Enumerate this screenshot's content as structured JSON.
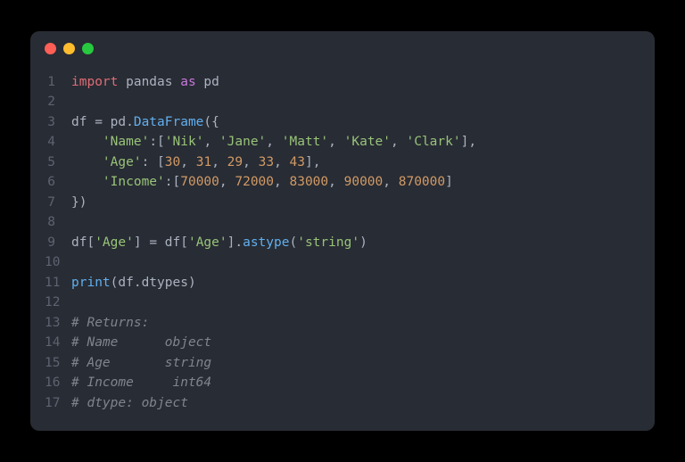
{
  "titlebar": {
    "buttons": [
      "close",
      "minimize",
      "maximize"
    ]
  },
  "code": {
    "lines": [
      {
        "n": "1",
        "tokens": [
          [
            "kw-import",
            "import"
          ],
          [
            "",
            ", "
          ],
          [
            "",
            "pandas "
          ],
          [
            "kw-as",
            "as"
          ],
          [
            "",
            " pd"
          ]
        ]
      },
      {
        "n": "2",
        "raw": ""
      },
      {
        "n": "3",
        "tokens": [
          [
            "",
            "df = pd."
          ],
          [
            "func",
            "DataFrame"
          ],
          [
            "",
            "({"
          ]
        ]
      },
      {
        "n": "4",
        "tokens": [
          [
            "",
            "    "
          ],
          [
            "str",
            "'Name'"
          ],
          [
            "",
            ":["
          ],
          [
            "str",
            "'Nik'"
          ],
          [
            "",
            ", "
          ],
          [
            "str",
            "'Jane'"
          ],
          [
            "",
            ", "
          ],
          [
            "str",
            "'Matt'"
          ],
          [
            "",
            ", "
          ],
          [
            "str",
            "'Kate'"
          ],
          [
            "",
            ", "
          ],
          [
            "str",
            "'Clark'"
          ],
          [
            "",
            "],"
          ]
        ]
      },
      {
        "n": "5",
        "tokens": [
          [
            "",
            "    "
          ],
          [
            "str",
            "'Age'"
          ],
          [
            "",
            ": ["
          ],
          [
            "num",
            "30"
          ],
          [
            "",
            ", "
          ],
          [
            "num",
            "31"
          ],
          [
            "",
            ", "
          ],
          [
            "num",
            "29"
          ],
          [
            "",
            ", "
          ],
          [
            "num",
            "33"
          ],
          [
            "",
            ", "
          ],
          [
            "num",
            "43"
          ],
          [
            "",
            "],"
          ]
        ]
      },
      {
        "n": "6",
        "tokens": [
          [
            "",
            "    "
          ],
          [
            "str",
            "'Income'"
          ],
          [
            "",
            ":["
          ],
          [
            "num",
            "70000"
          ],
          [
            "",
            ", "
          ],
          [
            "num",
            "72000"
          ],
          [
            "",
            ", "
          ],
          [
            "num",
            "83000"
          ],
          [
            "",
            ", "
          ],
          [
            "num",
            "90000"
          ],
          [
            "",
            ", "
          ],
          [
            "num",
            "870000"
          ],
          [
            "",
            "]"
          ]
        ]
      },
      {
        "n": "7",
        "tokens": [
          [
            "",
            "})"
          ]
        ]
      },
      {
        "n": "8",
        "raw": ""
      },
      {
        "n": "9",
        "tokens": [
          [
            "",
            "df["
          ],
          [
            "str",
            "'Age'"
          ],
          [
            "",
            "] = df["
          ],
          [
            "str",
            "'Age'"
          ],
          [
            "",
            "]."
          ],
          [
            "func",
            "astype"
          ],
          [
            "",
            "("
          ],
          [
            "str",
            "'string'"
          ],
          [
            "",
            ")"
          ]
        ]
      },
      {
        "n": "10",
        "raw": ""
      },
      {
        "n": "11",
        "tokens": [
          [
            "func",
            "print"
          ],
          [
            "",
            "(df.dtypes)"
          ]
        ]
      },
      {
        "n": "12",
        "raw": ""
      },
      {
        "n": "13",
        "tokens": [
          [
            "comment",
            "# Returns:"
          ]
        ]
      },
      {
        "n": "14",
        "tokens": [
          [
            "comment",
            "# Name      object"
          ]
        ]
      },
      {
        "n": "15",
        "tokens": [
          [
            "comment",
            "# Age       string"
          ]
        ]
      },
      {
        "n": "16",
        "tokens": [
          [
            "comment",
            "# Income     int64"
          ]
        ]
      },
      {
        "n": "17",
        "tokens": [
          [
            "comment",
            "# dtype: object"
          ]
        ]
      }
    ],
    "line1": {
      "import": "import",
      "pandas": " pandas ",
      "as": "as",
      "pd": " pd"
    }
  }
}
